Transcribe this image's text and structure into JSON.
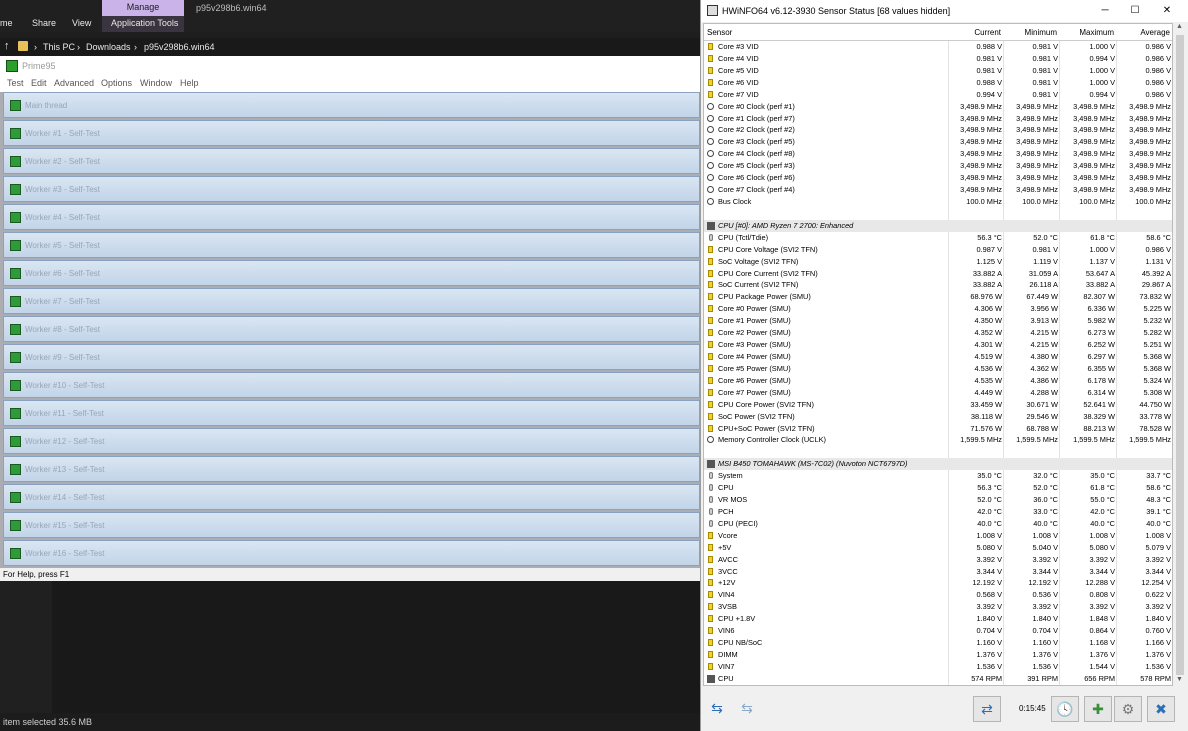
{
  "explorer": {
    "ribbon_tabs": [
      "me",
      "Share",
      "View",
      "Application Tools"
    ],
    "manage_tab": "Manage",
    "window_title": "p95v298b6.win64",
    "breadcrumb": [
      "This PC",
      "Downloads",
      "p95v298b6.win64"
    ],
    "status": "item selected  35.6 MB"
  },
  "prime95": {
    "title": "Prime95",
    "menu": [
      "Test",
      "Edit",
      "Advanced",
      "Options",
      "Window",
      "Help"
    ],
    "threads": [
      "Main thread",
      "Worker #1 - Self-Test",
      "Worker #2 - Self-Test",
      "Worker #3 - Self-Test",
      "Worker #4 - Self-Test",
      "Worker #5 - Self-Test",
      "Worker #6 - Self-Test",
      "Worker #7 - Self-Test",
      "Worker #8 - Self-Test",
      "Worker #9 - Self-Test",
      "Worker #10 - Self-Test",
      "Worker #11 - Self-Test",
      "Worker #12 - Self-Test",
      "Worker #13 - Self-Test",
      "Worker #14 - Self-Test",
      "Worker #15 - Self-Test",
      "Worker #16 - Self-Test"
    ],
    "status": "For Help, press F1"
  },
  "hwinfo": {
    "title": "HWiNFO64 v6.12-3930 Sensor Status [68 values hidden]",
    "headers": [
      "Sensor",
      "Current",
      "Minimum",
      "Maximum",
      "Average"
    ],
    "rows": [
      {
        "icon": "volt",
        "name": "Core #3 VID",
        "cur": "0.988 V",
        "min": "0.981 V",
        "max": "1.000 V",
        "avg": "0.986 V"
      },
      {
        "icon": "volt",
        "name": "Core #4 VID",
        "cur": "0.981 V",
        "min": "0.981 V",
        "max": "0.994 V",
        "avg": "0.986 V"
      },
      {
        "icon": "volt",
        "name": "Core #5 VID",
        "cur": "0.981 V",
        "min": "0.981 V",
        "max": "1.000 V",
        "avg": "0.986 V"
      },
      {
        "icon": "volt",
        "name": "Core #6 VID",
        "cur": "0.988 V",
        "min": "0.981 V",
        "max": "1.000 V",
        "avg": "0.986 V"
      },
      {
        "icon": "volt",
        "name": "Core #7 VID",
        "cur": "0.994 V",
        "min": "0.981 V",
        "max": "0.994 V",
        "avg": "0.986 V"
      },
      {
        "icon": "clock",
        "name": "Core #0 Clock (perf #1)",
        "cur": "3,498.9 MHz",
        "min": "3,498.9 MHz",
        "max": "3,498.9 MHz",
        "avg": "3,498.9 MHz"
      },
      {
        "icon": "clock",
        "name": "Core #1 Clock (perf #7)",
        "cur": "3,498.9 MHz",
        "min": "3,498.9 MHz",
        "max": "3,498.9 MHz",
        "avg": "3,498.9 MHz"
      },
      {
        "icon": "clock",
        "name": "Core #2 Clock (perf #2)",
        "cur": "3,498.9 MHz",
        "min": "3,498.9 MHz",
        "max": "3,498.9 MHz",
        "avg": "3,498.9 MHz"
      },
      {
        "icon": "clock",
        "name": "Core #3 Clock (perf #5)",
        "cur": "3,498.9 MHz",
        "min": "3,498.9 MHz",
        "max": "3,498.9 MHz",
        "avg": "3,498.9 MHz"
      },
      {
        "icon": "clock",
        "name": "Core #4 Clock (perf #8)",
        "cur": "3,498.9 MHz",
        "min": "3,498.9 MHz",
        "max": "3,498.9 MHz",
        "avg": "3,498.9 MHz"
      },
      {
        "icon": "clock",
        "name": "Core #5 Clock (perf #3)",
        "cur": "3,498.9 MHz",
        "min": "3,498.9 MHz",
        "max": "3,498.9 MHz",
        "avg": "3,498.9 MHz"
      },
      {
        "icon": "clock",
        "name": "Core #6 Clock (perf #6)",
        "cur": "3,498.9 MHz",
        "min": "3,498.9 MHz",
        "max": "3,498.9 MHz",
        "avg": "3,498.9 MHz"
      },
      {
        "icon": "clock",
        "name": "Core #7 Clock (perf #4)",
        "cur": "3,498.9 MHz",
        "min": "3,498.9 MHz",
        "max": "3,498.9 MHz",
        "avg": "3,498.9 MHz"
      },
      {
        "icon": "clock",
        "name": "Bus Clock",
        "cur": "100.0 MHz",
        "min": "100.0 MHz",
        "max": "100.0 MHz",
        "avg": "100.0 MHz"
      },
      {
        "spacer": true
      },
      {
        "group": true,
        "icon": "chip",
        "name": "CPU [#0]: AMD Ryzen 7 2700: Enhanced"
      },
      {
        "icon": "temp",
        "name": "CPU (Tctl/Tdie)",
        "cur": "56.3 °C",
        "min": "52.0 °C",
        "max": "61.8 °C",
        "avg": "58.6 °C"
      },
      {
        "icon": "volt",
        "name": "CPU Core Voltage (SVI2 TFN)",
        "cur": "0.987 V",
        "min": "0.981 V",
        "max": "1.000 V",
        "avg": "0.986 V"
      },
      {
        "icon": "volt",
        "name": "SoC Voltage (SVI2 TFN)",
        "cur": "1.125 V",
        "min": "1.119 V",
        "max": "1.137 V",
        "avg": "1.131 V"
      },
      {
        "icon": "volt",
        "name": "CPU Core Current (SVI2 TFN)",
        "cur": "33.882 A",
        "min": "31.059 A",
        "max": "53.647 A",
        "avg": "45.392 A"
      },
      {
        "icon": "volt",
        "name": "SoC Current (SVI2 TFN)",
        "cur": "33.882 A",
        "min": "26.118 A",
        "max": "33.882 A",
        "avg": "29.867 A"
      },
      {
        "icon": "volt",
        "name": "CPU Package Power (SMU)",
        "cur": "68.976 W",
        "min": "67.449 W",
        "max": "82.307 W",
        "avg": "73.832 W"
      },
      {
        "icon": "volt",
        "name": "Core #0 Power (SMU)",
        "cur": "4.306 W",
        "min": "3.956 W",
        "max": "6.336 W",
        "avg": "5.225 W"
      },
      {
        "icon": "volt",
        "name": "Core #1 Power (SMU)",
        "cur": "4.350 W",
        "min": "3.913 W",
        "max": "5.982 W",
        "avg": "5.232 W"
      },
      {
        "icon": "volt",
        "name": "Core #2 Power (SMU)",
        "cur": "4.352 W",
        "min": "4.215 W",
        "max": "6.273 W",
        "avg": "5.282 W"
      },
      {
        "icon": "volt",
        "name": "Core #3 Power (SMU)",
        "cur": "4.301 W",
        "min": "4.215 W",
        "max": "6.252 W",
        "avg": "5.251 W"
      },
      {
        "icon": "volt",
        "name": "Core #4 Power (SMU)",
        "cur": "4.519 W",
        "min": "4.380 W",
        "max": "6.297 W",
        "avg": "5.368 W"
      },
      {
        "icon": "volt",
        "name": "Core #5 Power (SMU)",
        "cur": "4.536 W",
        "min": "4.362 W",
        "max": "6.355 W",
        "avg": "5.368 W"
      },
      {
        "icon": "volt",
        "name": "Core #6 Power (SMU)",
        "cur": "4.535 W",
        "min": "4.386 W",
        "max": "6.178 W",
        "avg": "5.324 W"
      },
      {
        "icon": "volt",
        "name": "Core #7 Power (SMU)",
        "cur": "4.449 W",
        "min": "4.288 W",
        "max": "6.314 W",
        "avg": "5.308 W"
      },
      {
        "icon": "volt",
        "name": "CPU Core Power (SVI2 TFN)",
        "cur": "33.459 W",
        "min": "30.671 W",
        "max": "52.641 W",
        "avg": "44.750 W"
      },
      {
        "icon": "volt",
        "name": "SoC Power (SVI2 TFN)",
        "cur": "38.118 W",
        "min": "29.546 W",
        "max": "38.329 W",
        "avg": "33.778 W"
      },
      {
        "icon": "volt",
        "name": "CPU+SoC Power (SVI2 TFN)",
        "cur": "71.576 W",
        "min": "68.788 W",
        "max": "88.213 W",
        "avg": "78.528 W"
      },
      {
        "icon": "clock",
        "name": "Memory Controller Clock (UCLK)",
        "cur": "1,599.5 MHz",
        "min": "1,599.5 MHz",
        "max": "1,599.5 MHz",
        "avg": "1,599.5 MHz"
      },
      {
        "spacer": true
      },
      {
        "group": true,
        "icon": "chip",
        "name": "MSI B450 TOMAHAWK (MS-7C02) (Nuvoton NCT6797D)"
      },
      {
        "icon": "temp",
        "name": "System",
        "cur": "35.0 °C",
        "min": "32.0 °C",
        "max": "35.0 °C",
        "avg": "33.7 °C"
      },
      {
        "icon": "temp",
        "name": "CPU",
        "cur": "56.3 °C",
        "min": "52.0 °C",
        "max": "61.8 °C",
        "avg": "58.6 °C"
      },
      {
        "icon": "temp",
        "name": "VR MOS",
        "cur": "52.0 °C",
        "min": "36.0 °C",
        "max": "55.0 °C",
        "avg": "48.3 °C"
      },
      {
        "icon": "temp",
        "name": "PCH",
        "cur": "42.0 °C",
        "min": "33.0 °C",
        "max": "42.0 °C",
        "avg": "39.1 °C"
      },
      {
        "icon": "temp",
        "name": "CPU (PECI)",
        "cur": "40.0 °C",
        "min": "40.0 °C",
        "max": "40.0 °C",
        "avg": "40.0 °C"
      },
      {
        "icon": "volt",
        "name": "Vcore",
        "cur": "1.008 V",
        "min": "1.008 V",
        "max": "1.008 V",
        "avg": "1.008 V"
      },
      {
        "icon": "volt",
        "name": "+5V",
        "cur": "5.080 V",
        "min": "5.040 V",
        "max": "5.080 V",
        "avg": "5.079 V"
      },
      {
        "icon": "volt",
        "name": "AVCC",
        "cur": "3.392 V",
        "min": "3.392 V",
        "max": "3.392 V",
        "avg": "3.392 V"
      },
      {
        "icon": "volt",
        "name": "3VCC",
        "cur": "3.344 V",
        "min": "3.344 V",
        "max": "3.344 V",
        "avg": "3.344 V"
      },
      {
        "icon": "volt",
        "name": "+12V",
        "cur": "12.192 V",
        "min": "12.192 V",
        "max": "12.288 V",
        "avg": "12.254 V"
      },
      {
        "icon": "volt",
        "name": "VIN4",
        "cur": "0.568 V",
        "min": "0.536 V",
        "max": "0.808 V",
        "avg": "0.622 V"
      },
      {
        "icon": "volt",
        "name": "3VSB",
        "cur": "3.392 V",
        "min": "3.392 V",
        "max": "3.392 V",
        "avg": "3.392 V"
      },
      {
        "icon": "volt",
        "name": "CPU +1.8V",
        "cur": "1.840 V",
        "min": "1.840 V",
        "max": "1.848 V",
        "avg": "1.840 V"
      },
      {
        "icon": "volt",
        "name": "VIN6",
        "cur": "0.704 V",
        "min": "0.704 V",
        "max": "0.864 V",
        "avg": "0.760 V"
      },
      {
        "icon": "volt",
        "name": "CPU NB/SoC",
        "cur": "1.160 V",
        "min": "1.160 V",
        "max": "1.168 V",
        "avg": "1.166 V"
      },
      {
        "icon": "volt",
        "name": "DIMM",
        "cur": "1.376 V",
        "min": "1.376 V",
        "max": "1.376 V",
        "avg": "1.376 V"
      },
      {
        "icon": "volt",
        "name": "VIN7",
        "cur": "1.536 V",
        "min": "1.536 V",
        "max": "1.544 V",
        "avg": "1.536 V"
      },
      {
        "icon": "fan",
        "name": "CPU",
        "cur": "574 RPM",
        "min": "391 RPM",
        "max": "656 RPM",
        "avg": "578 RPM"
      }
    ],
    "timer": "0:15:45"
  }
}
